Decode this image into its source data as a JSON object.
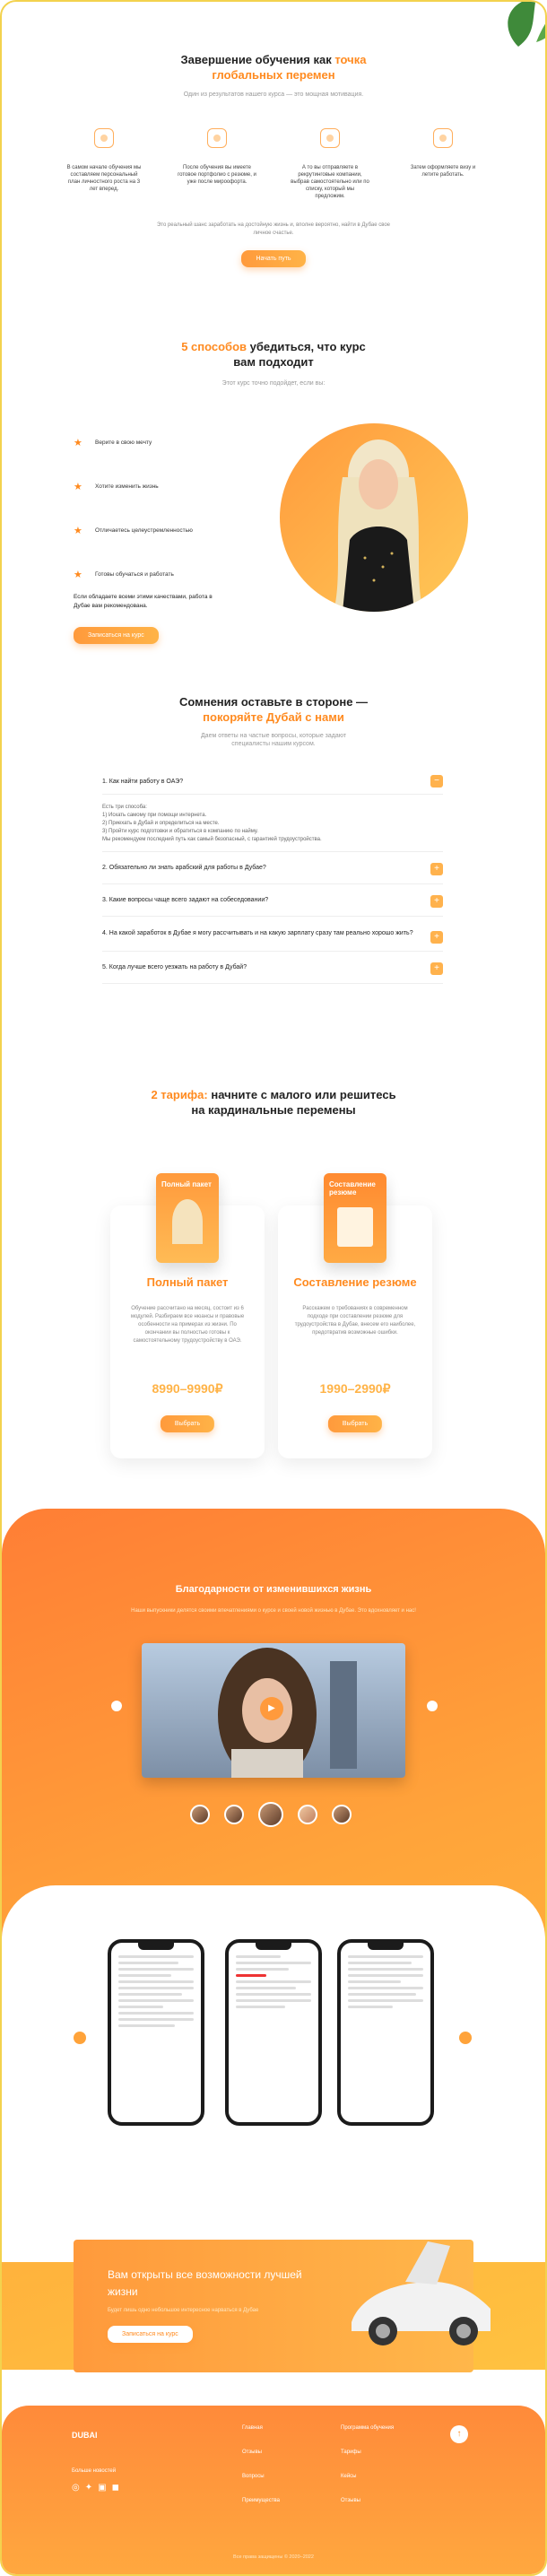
{
  "results": {
    "title_plain": "Завершение обучения как ",
    "title_accent": "точка",
    "title_accent2": "глобальных перемен",
    "subtitle": "Один из результатов нашего курса — это мощная мотивация.",
    "steps": [
      "В самом начале обучения мы составляем персональный план личностного роста на 3 лет вперед.",
      "После обучения вы имеете готовое портфолио с резюме, и уже после мироофорта.",
      "А то вы отправляете в рекрутинговые компании, выбрав самостоятельно или по списку, который мы предложим.",
      "Затем оформляете визу и летите работать."
    ],
    "note": "Это реальный шанс заработать на достойную жизнь и, вполне вероятно, найти в Дубае свое личное счастье.",
    "button": "Начать путь"
  },
  "ways": {
    "title_accent": "5 способов",
    "title_plain": " убедиться, что курс",
    "title_line2": "вам подходит",
    "subtitle": "Этот курс точно подойдет, если вы:",
    "items": [
      "Верите в свою мечту",
      "Хотите изменить жизнь",
      "Отличаетесь целеустремленностью",
      "Готовы обучаться и работать"
    ],
    "closing": "Если обладаете всеми этими качествами, работа в Дубае вам рекомендована.",
    "button": "Записаться на курс"
  },
  "faq": {
    "title_plain": "Сомнения оставьте в стороне —",
    "title_accent": "покоряйте Дубай с нами",
    "subtitle": "Даем ответы на частые вопросы, которые задают специалисты нашим курсом.",
    "items": [
      {
        "q": "1. Как найти работу в ОАЭ?",
        "a": [
          "Есть три способа:",
          "1) Искать самому при помощи интернета.",
          "2) Приехать в Дубай и определиться на месте.",
          "3) Пройти курс подготовки и обратиться в компанию по найму.",
          "Мы рекомендуем последний путь как самый безопасный, с гарантией трудоустройства."
        ],
        "icon": "minus"
      },
      {
        "q": "2. Обязательно ли знать арабский для работы в Дубае?",
        "icon": "plus"
      },
      {
        "q": "3. Какие вопросы чаще всего задают на собеседовании?",
        "icon": "plus"
      },
      {
        "q": "4. На какой заработок в Дубае я могу рассчитывать и на какую зарплату сразу там реально хорошо жить?",
        "icon": "plus"
      },
      {
        "q": "5. Когда лучше всего уезжать на работу в Дубай?",
        "icon": "plus"
      }
    ]
  },
  "tariffs": {
    "title_accent": "2 тарифа:",
    "title_plain": " начните с малого или решитесь",
    "title_line2": "на кардинальные перемены",
    "cards": [
      {
        "pack": "Полный пакет",
        "title": "Полный пакет",
        "desc": "Обучение рассчитано на месяц, состоит из 6 модулей. Разбираем все нюансы и правовые особенности на примерах из жизни. По окончании вы полностью готовы к самостоятельному трудоустройству в ОАЭ.",
        "price": "8990–9990₽",
        "button": "Выбрать"
      },
      {
        "pack": "Составление резюме",
        "title": "Составление резюме",
        "desc": "Расскажем о требованиях в современном подходе при составлении резюме для трудоустройства в Дубае, внесем его наиболее, предотвратив возможные ошибки.",
        "price": "1990–2990₽",
        "button": "Выбрать"
      }
    ]
  },
  "reviews": {
    "title": "Благодарности от изменившихся жизнь",
    "subtitle": "Наши выпускники делятся своими впечатлениями о курсе и своей новой жизнью в Дубае. Это вдохновляет и нас!"
  },
  "banner": {
    "title": "Вам открыты все возможности лучшей жизни",
    "subtitle": "Будет лишь одно небольшое интересное нарваться в Дубае",
    "button": "Записаться на курс"
  },
  "footer": {
    "logo": "DUBAI",
    "social_label": "Больше новостей",
    "col1": [
      "Главная",
      "Отзывы",
      "Вопросы",
      "Преимущества"
    ],
    "col2": [
      "Программа обучения",
      "Тарифы",
      "Кейсы",
      "Отзывы"
    ],
    "copyright": "Все права защищены © 2020–2022"
  }
}
